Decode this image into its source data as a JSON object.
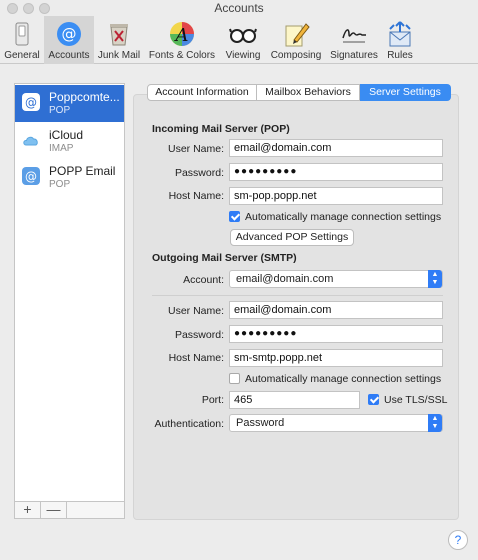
{
  "window": {
    "title": "Accounts"
  },
  "toolbar": {
    "items": [
      {
        "label": "General",
        "icon": "general-switch-icon"
      },
      {
        "label": "Accounts",
        "icon": "at-sign-icon"
      },
      {
        "label": "Junk Mail",
        "icon": "trash-bin-icon"
      },
      {
        "label": "Fonts & Colors",
        "icon": "font-palette-icon"
      },
      {
        "label": "Viewing",
        "icon": "glasses-icon"
      },
      {
        "label": "Composing",
        "icon": "pencil-note-icon"
      },
      {
        "label": "Signatures",
        "icon": "signature-icon"
      },
      {
        "label": "Rules",
        "icon": "rules-envelope-icon"
      }
    ],
    "selected": "Accounts"
  },
  "sidebar": {
    "accounts": [
      {
        "name": "Poppcomte...",
        "type": "POP",
        "icon": "at-sign-icon"
      },
      {
        "name": "iCloud",
        "type": "IMAP",
        "icon": "cloud-icon"
      },
      {
        "name": "POPP Email",
        "type": "POP",
        "icon": "at-sign-icon"
      }
    ],
    "add_label": "+",
    "remove_label": "—"
  },
  "tabs": [
    {
      "label": "Account Information",
      "active": false
    },
    {
      "label": "Mailbox Behaviors",
      "active": false
    },
    {
      "label": "Server Settings",
      "active": true
    }
  ],
  "incoming": {
    "title": "Incoming Mail Server (POP)",
    "username_label": "User Name:",
    "username": "email@domain.com",
    "password_label": "Password:",
    "password": "●●●●●●●●●",
    "host_label": "Host Name:",
    "host": "sm-pop.popp.net",
    "auto_manage_label": "Automatically manage connection settings",
    "auto_manage": true,
    "advanced_button": "Advanced POP Settings"
  },
  "outgoing": {
    "title": "Outgoing Mail Server (SMTP)",
    "account_label": "Account:",
    "account": "email@domain.com",
    "username_label": "User Name:",
    "username": "email@domain.com",
    "password_label": "Password:",
    "password": "●●●●●●●●●",
    "host_label": "Host Name:",
    "host": "sm-smtp.popp.net",
    "auto_manage_label": "Automatically manage connection settings",
    "auto_manage": false,
    "port_label": "Port:",
    "port": "465",
    "tls_label": "Use TLS/SSL",
    "tls": true,
    "auth_label": "Authentication:",
    "auth": "Password"
  },
  "help_label": "?",
  "colors": {
    "accent": "#2f7cf6",
    "selection": "#2f6fd3"
  }
}
